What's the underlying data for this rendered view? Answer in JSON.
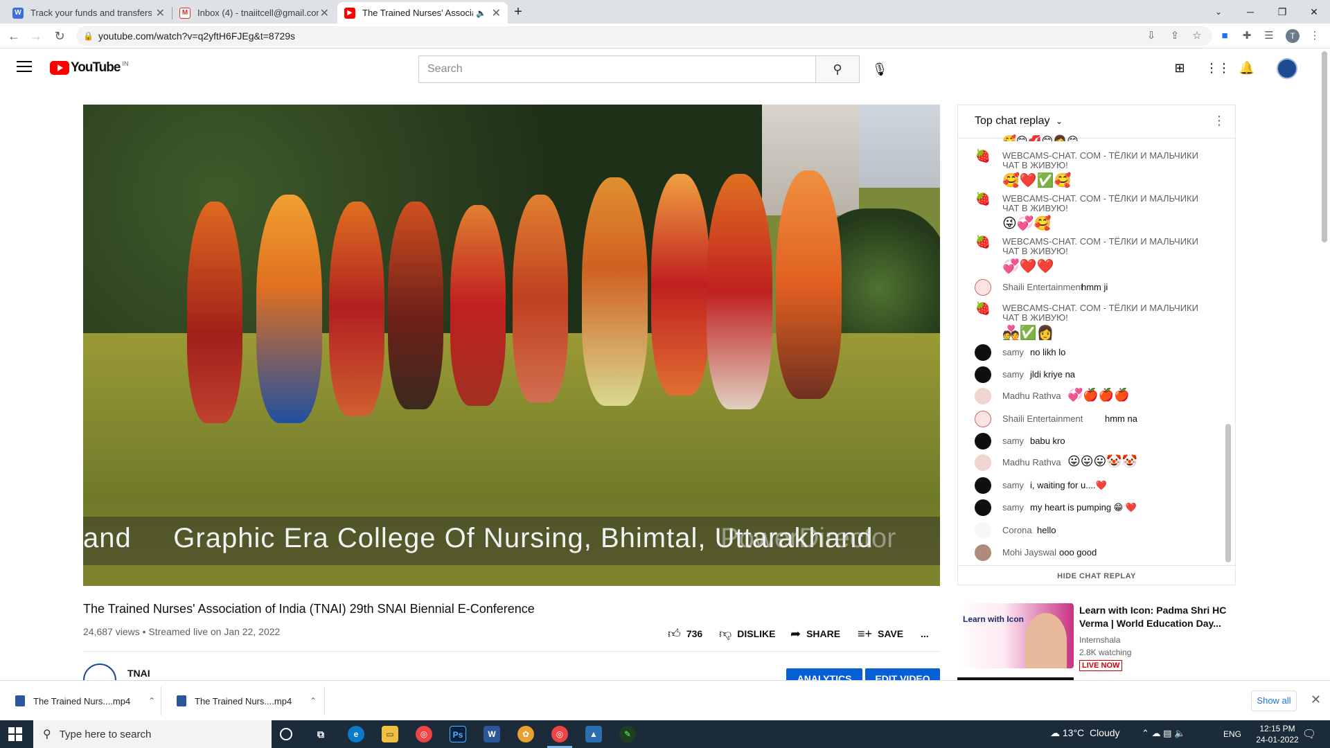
{
  "browser": {
    "tabs": [
      {
        "label": "Track your funds and transfers on",
        "favicon": "wave-icon",
        "color": "#3b6fe0"
      },
      {
        "label": "Inbox (4) - tnaiitcell@gmail.com",
        "favicon": "gmail-icon",
        "color": "#d93025"
      },
      {
        "label": "The Trained Nurses' Association",
        "favicon": "youtube-icon",
        "color": "#ff0000"
      }
    ],
    "url": "youtube.com/watch?v=q2yftH6FJEg&t=8729s"
  },
  "youtube": {
    "logo_text": "YouTube",
    "country_code": "IN",
    "search_placeholder": "Search"
  },
  "video": {
    "caption": "and     Graphic Era College Of Nursing, Bhimtal, Uttarakhand",
    "watermark": "PowerDirector",
    "title": "The Trained Nurses' Association of India (TNAI) 29th SNAI Biennial E-Conference",
    "meta": "24,687 views • Streamed live on Jan 22, 2022",
    "likes": "736",
    "dislike_label": "DISLIKE",
    "share_label": "SHARE",
    "save_label": "SAVE",
    "more_label": "...",
    "channel": "TNAI",
    "analytics_label": "ANALYTICS",
    "edit_label": "EDIT VIDEO"
  },
  "chat": {
    "title": "Top chat replay",
    "hide_label": "HIDE CHAT REPLAY",
    "messages": [
      {
        "author": "WEBCAMS-CHAT. COM - ТЁЛКИ И МАЛЬЧИКИ ЧАТ В ЖИВУЮ!",
        "text": "🥰❤️✅🥰"
      },
      {
        "author": "WEBCAMS-CHAT. COM - ТЁЛКИ И МАЛЬЧИКИ ЧАТ В ЖИВУЮ!",
        "text": "😜💞🥰"
      },
      {
        "author": "WEBCAMS-CHAT. COM - ТЁЛКИ И МАЛЬЧИКИ ЧАТ В ЖИВУЮ!",
        "text": "💞❤️❤️"
      },
      {
        "author": "Shaili Entertainment",
        "text": "hmm ji"
      },
      {
        "author": "WEBCAMS-CHAT. COM - ТЁЛКИ И МАЛЬЧИКИ ЧАТ В ЖИВУЮ!",
        "text": "💑✅👩"
      },
      {
        "author": "samy",
        "text": "no likh lo"
      },
      {
        "author": "samy",
        "text": "jldi kriye na"
      },
      {
        "author": "Madhu Rathva",
        "text": "💞🍎🍎🍎"
      },
      {
        "author": "Shaili Entertainment",
        "text": "hmm na"
      },
      {
        "author": "samy",
        "text": "babu kro"
      },
      {
        "author": "Madhu Rathva",
        "text": "😛😛😛🤡🤡"
      },
      {
        "author": "samy",
        "text": "i, waiting for u....❤️"
      },
      {
        "author": "samy",
        "text": "my heart is pumping 😁 ❤️"
      },
      {
        "author": "Corona",
        "text": "hello"
      },
      {
        "author": "Mohi Jayswal",
        "text": "ooo good"
      }
    ]
  },
  "recommendation": {
    "thumb_text": "Learn with Icon",
    "title": "Learn with Icon: Padma Shri HC Verma | World Education Day...",
    "channel": "Internshala",
    "watching": "2.8K watching",
    "live": "LIVE NOW"
  },
  "downloads": {
    "items": [
      "The Trained Nurs....mp4",
      "The Trained Nurs....mp4"
    ],
    "show_all": "Show all"
  },
  "taskbar": {
    "search_placeholder": "Type here to search",
    "weather": "13°C  Cloudy",
    "lang": "ENG",
    "time": "12:15 PM",
    "date": "24-01-2022"
  }
}
